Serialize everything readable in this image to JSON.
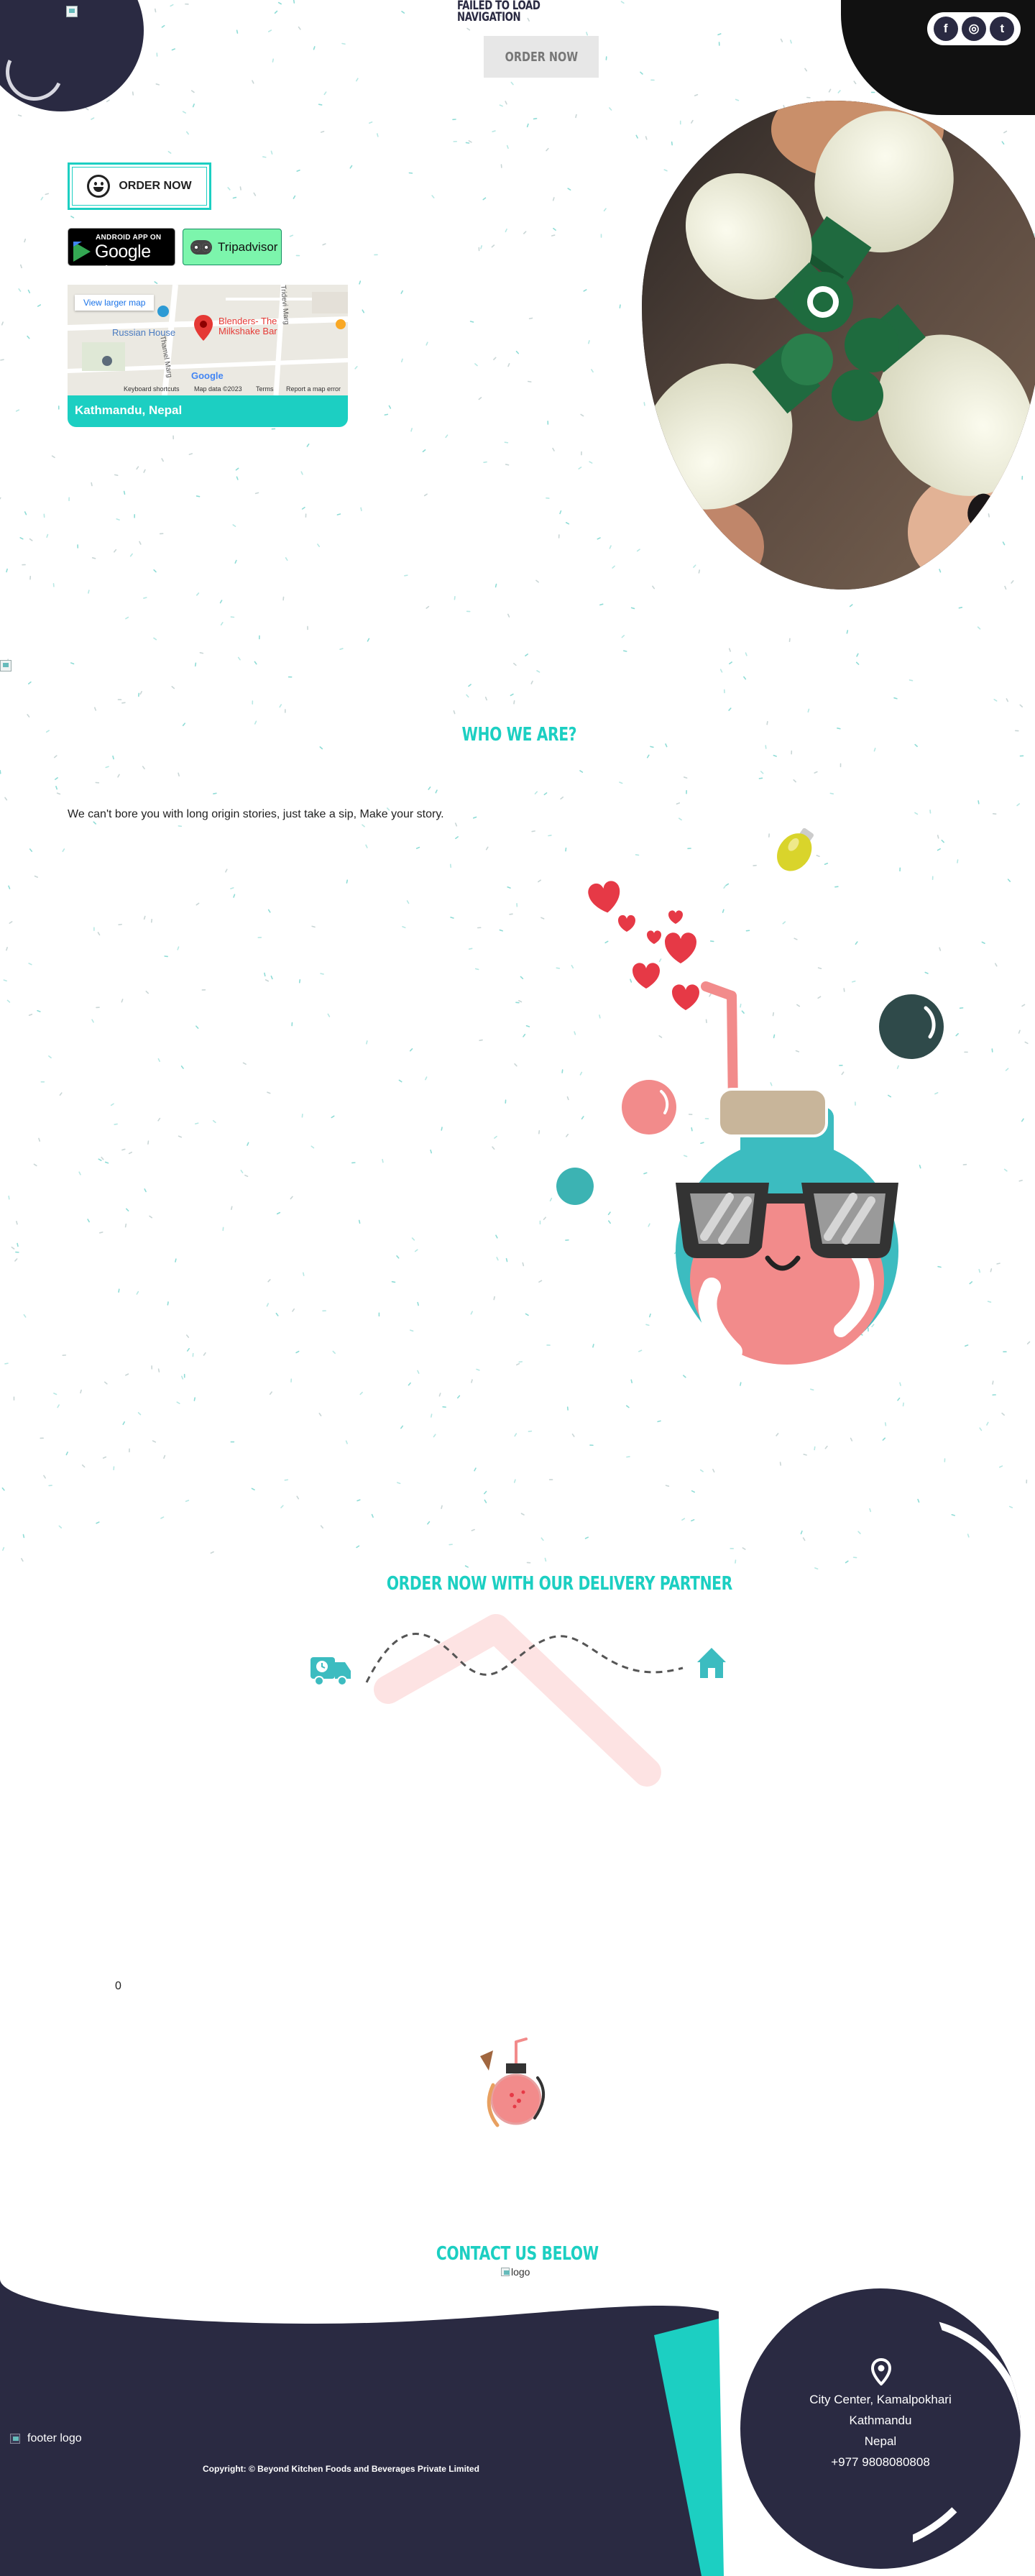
{
  "header": {
    "nav_error": "FAILED TO LOAD NAVIGATION",
    "order_button": "ORDER NOW",
    "social": [
      "f",
      "◎",
      "t"
    ]
  },
  "hero": {
    "order_now": "ORDER NOW",
    "google_play_line1": "ANDROID APP ON",
    "google_play_line2": "Google play",
    "tripadvisor": "Tripadvisor",
    "map": {
      "view_larger": "View larger map",
      "russian_house": "Russian House",
      "place": "Blenders- The Milkshake Bar",
      "street": "Thamel Marg",
      "road": "Tridevi Marg",
      "shortcuts": "Keyboard shortcuts",
      "map_data": "Map data ©2023",
      "terms": "Terms",
      "report": "Report a map error",
      "google": "Google"
    },
    "location_caption": "Kathmandu, Nepal"
  },
  "about": {
    "title": "WHO WE ARE?",
    "text": "We can't bore you with long origin stories, just take a sip, Make your story."
  },
  "delivery": {
    "title": "ORDER NOW WITH OUR DELIVERY PARTNER",
    "stat": "0"
  },
  "contact": {
    "title": "CONTACT US BELOW",
    "logo_alt": "logo",
    "address_line1": "City Center, Kamalpokhari",
    "address_line2": "Kathmandu",
    "address_line3": "Nepal",
    "phone": "+977 9808080808"
  },
  "footer": {
    "logo_alt": "footer logo",
    "copyright": "Copyright: © Beyond Kitchen Foods and Beverages Private Limited"
  },
  "colors": {
    "teal": "#1ccfc2",
    "navy": "#2a2a42",
    "pink": "#f28b8b",
    "red": "#e63946"
  }
}
